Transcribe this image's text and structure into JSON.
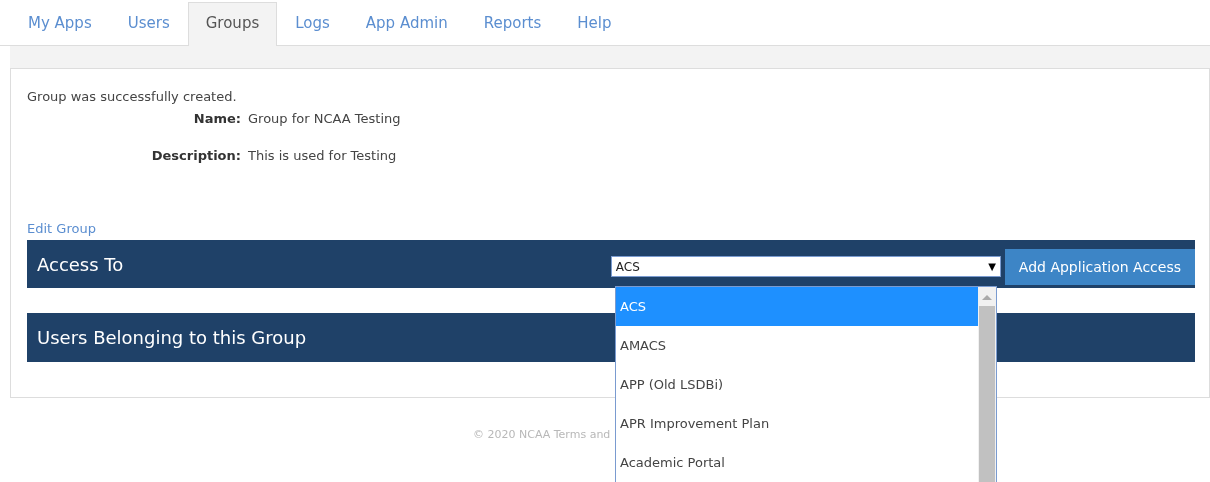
{
  "tabs": [
    {
      "label": "My Apps",
      "selected": false
    },
    {
      "label": "Users",
      "selected": false
    },
    {
      "label": "Groups",
      "selected": true
    },
    {
      "label": "Logs",
      "selected": false
    },
    {
      "label": "App Admin",
      "selected": false
    },
    {
      "label": "Reports",
      "selected": false
    },
    {
      "label": "Help",
      "selected": false
    }
  ],
  "message": "Group was successfully created.",
  "details": [
    {
      "label": "Name:",
      "value": "Group for NCAA Testing"
    },
    {
      "label": "Description:",
      "value": "This is used for Testing"
    }
  ],
  "edit_link": "Edit Group",
  "access_section": {
    "title": "Access To",
    "select": {
      "value": "ACS",
      "arrow": "▼",
      "expanded": true,
      "options": [
        {
          "label": "ACS",
          "selected": true
        },
        {
          "label": "AMACS",
          "selected": false
        },
        {
          "label": "APP (Old LSDBi)",
          "selected": false
        },
        {
          "label": "APR Improvement Plan",
          "selected": false
        },
        {
          "label": "Academic Portal",
          "selected": false
        }
      ]
    },
    "button": "Add Application Access"
  },
  "users_section": {
    "title": "Users Belonging to this Group"
  },
  "footer": "© 2020 NCAA Terms and"
}
